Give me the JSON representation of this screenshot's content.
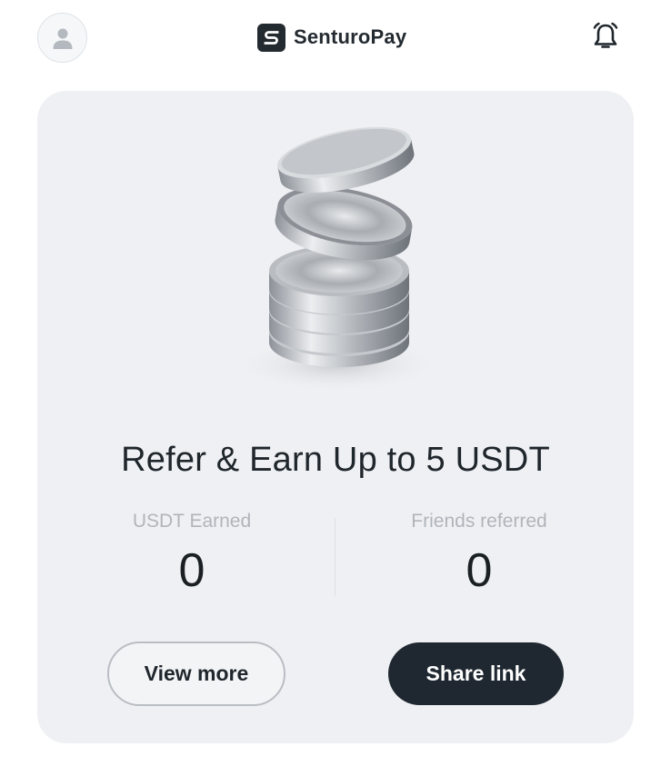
{
  "header": {
    "app_name": "SenturoPay",
    "avatar_icon": "user-icon",
    "bell_icon": "bell-icon",
    "logo_icon": "senturopay-logo-icon"
  },
  "referral_card": {
    "title": "Refer & Earn Up to 5 USDT",
    "illustration": "coin-stack-illustration",
    "stats": [
      {
        "label": "USDT Earned",
        "value": "0"
      },
      {
        "label": "Friends referred",
        "value": "0"
      }
    ],
    "view_more_label": "View more",
    "share_link_label": "Share link"
  },
  "colors": {
    "primary_dark": "#1f2830",
    "card_background": "#eff0f3",
    "muted_text": "#b0b5bb"
  }
}
